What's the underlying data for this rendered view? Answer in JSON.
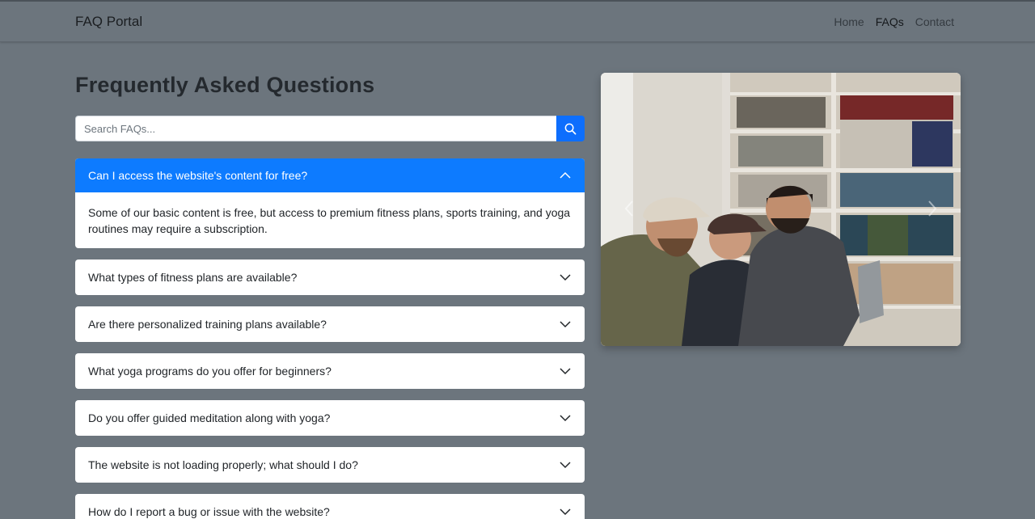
{
  "nav": {
    "brand": "FAQ Portal",
    "links": [
      "Home",
      "FAQs",
      "Contact"
    ]
  },
  "page": {
    "title": "Frequently Asked Questions"
  },
  "search": {
    "placeholder": "Search FAQs...",
    "icon": "search-icon"
  },
  "faqs": [
    {
      "question": "Can I access the website's content for free?",
      "answer": "Some of our basic content is free, but access to premium fitness plans, sports training, and yoga routines may require a subscription.",
      "open": true
    },
    {
      "question": "What types of fitness plans are available?",
      "open": false
    },
    {
      "question": "Are there personalized training plans available?",
      "open": false
    },
    {
      "question": "What yoga programs do you offer for beginners?",
      "open": false
    },
    {
      "question": "Do you offer guided meditation along with yoga?",
      "open": false
    },
    {
      "question": "The website is not loading properly; what should I do?",
      "open": false
    },
    {
      "question": "How do I report a bug or issue with the website?",
      "open": false
    }
  ],
  "colors": {
    "page_bg": "#6c757d",
    "accent": "#0d7bff",
    "search_button": "#0d6efd"
  }
}
